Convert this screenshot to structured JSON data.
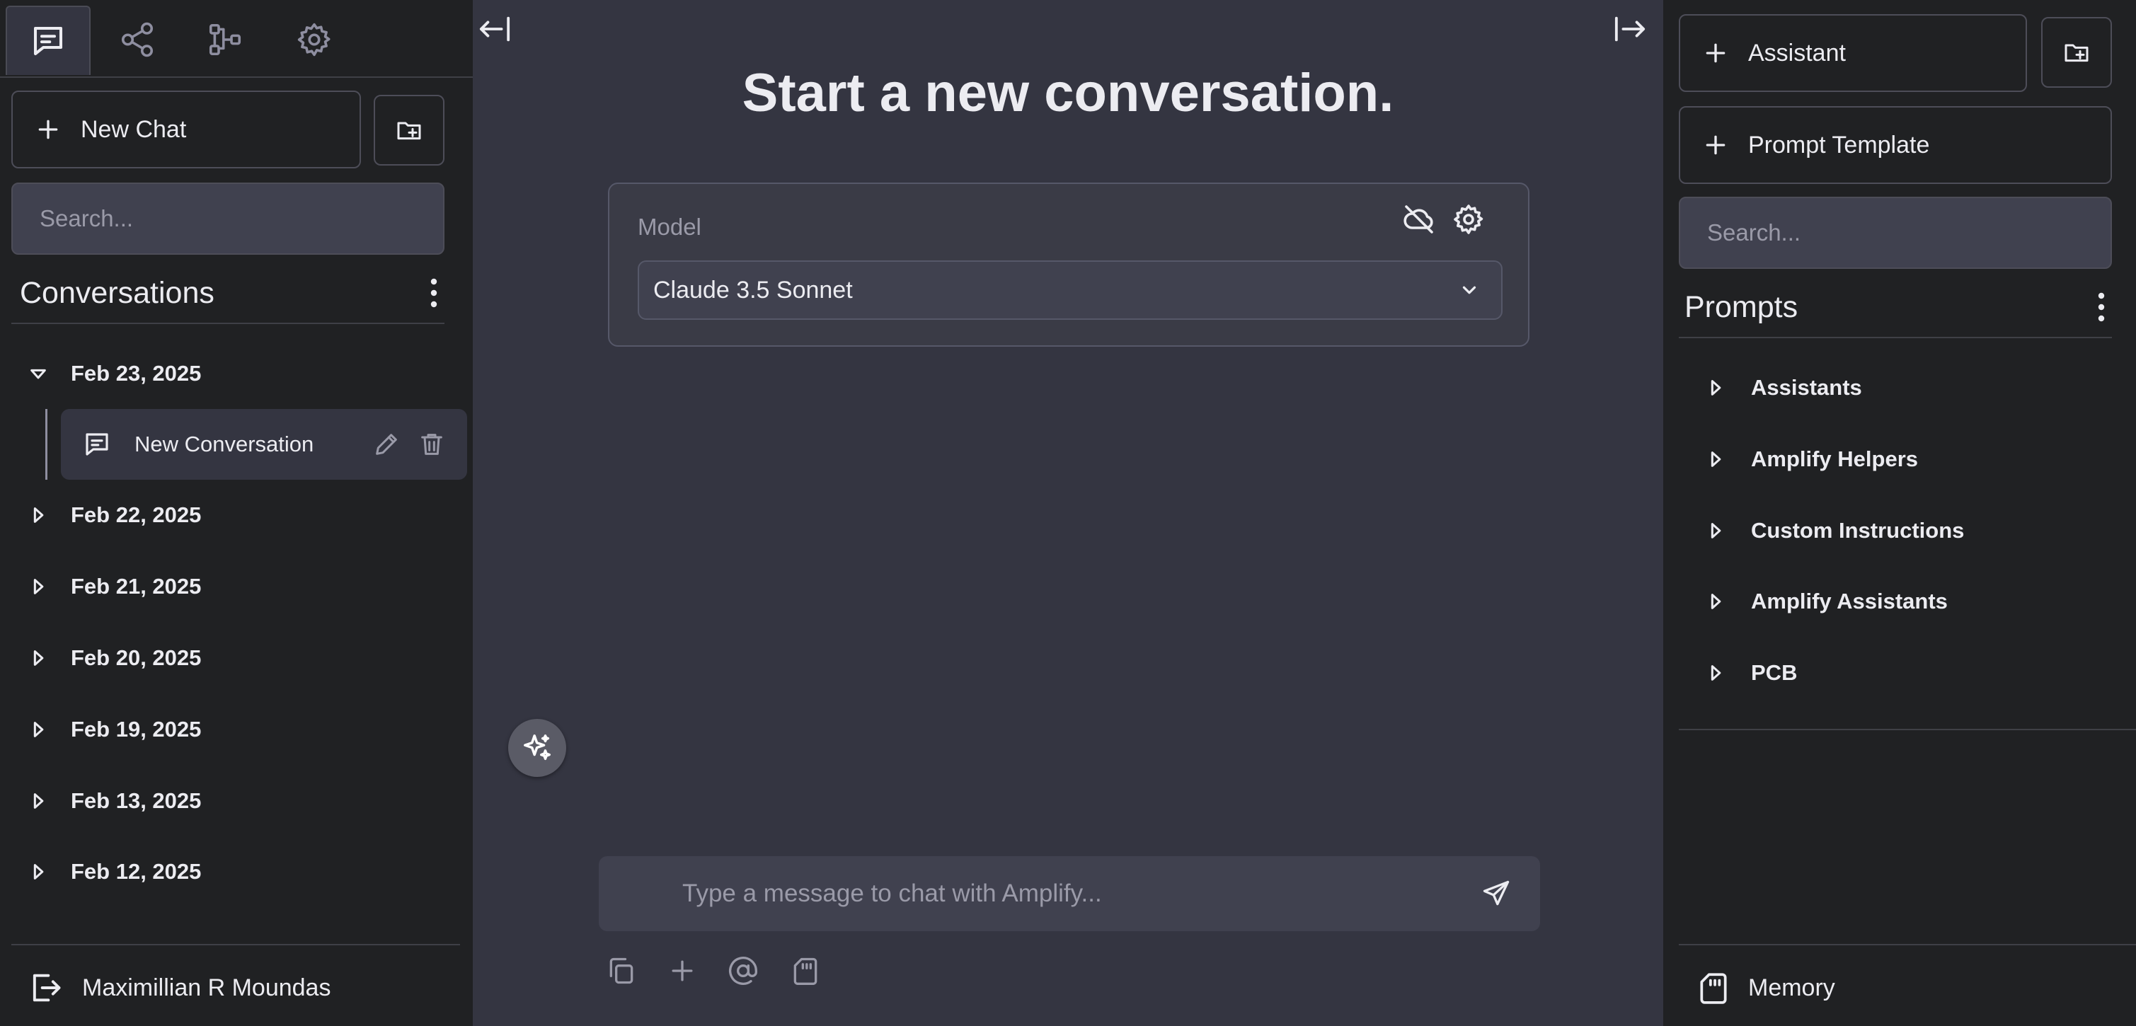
{
  "left_sidebar": {
    "tabs": [
      {
        "icon": "chat-icon",
        "active": true
      },
      {
        "icon": "share-icon",
        "active": false
      },
      {
        "icon": "workflow-icon",
        "active": false
      },
      {
        "icon": "settings-icon",
        "active": false
      }
    ],
    "new_chat_label": "New Chat",
    "search_placeholder": "Search...",
    "section_title": "Conversations",
    "groups": [
      {
        "label": "Feb 23, 2025",
        "expanded": true
      },
      {
        "label": "Feb 22, 2025",
        "expanded": false
      },
      {
        "label": "Feb 21, 2025",
        "expanded": false
      },
      {
        "label": "Feb 20, 2025",
        "expanded": false
      },
      {
        "label": "Feb 19, 2025",
        "expanded": false
      },
      {
        "label": "Feb 13, 2025",
        "expanded": false
      },
      {
        "label": "Feb 12, 2025",
        "expanded": false
      }
    ],
    "active_conversation": "New Conversation",
    "user_name": "Maximillian R Moundas"
  },
  "main": {
    "title": "Start a new conversation.",
    "model_label": "Model",
    "model_value": "Claude 3.5 Sonnet",
    "input_placeholder": "Type a message to chat with Amplify..."
  },
  "right_sidebar": {
    "assistant_label": "Assistant",
    "prompt_template_label": "Prompt Template",
    "search_placeholder": "Search...",
    "section_title": "Prompts",
    "folders": [
      "Assistants",
      "Amplify Helpers",
      "Custom Instructions",
      "Amplify Assistants",
      "PCB"
    ],
    "memory_label": "Memory"
  },
  "colors": {
    "sidebar_bg": "#202123",
    "main_bg": "#343541",
    "input_bg": "#40414f",
    "border": "#4d4d58",
    "text": "#ececf1",
    "muted": "#9a9aa8"
  }
}
